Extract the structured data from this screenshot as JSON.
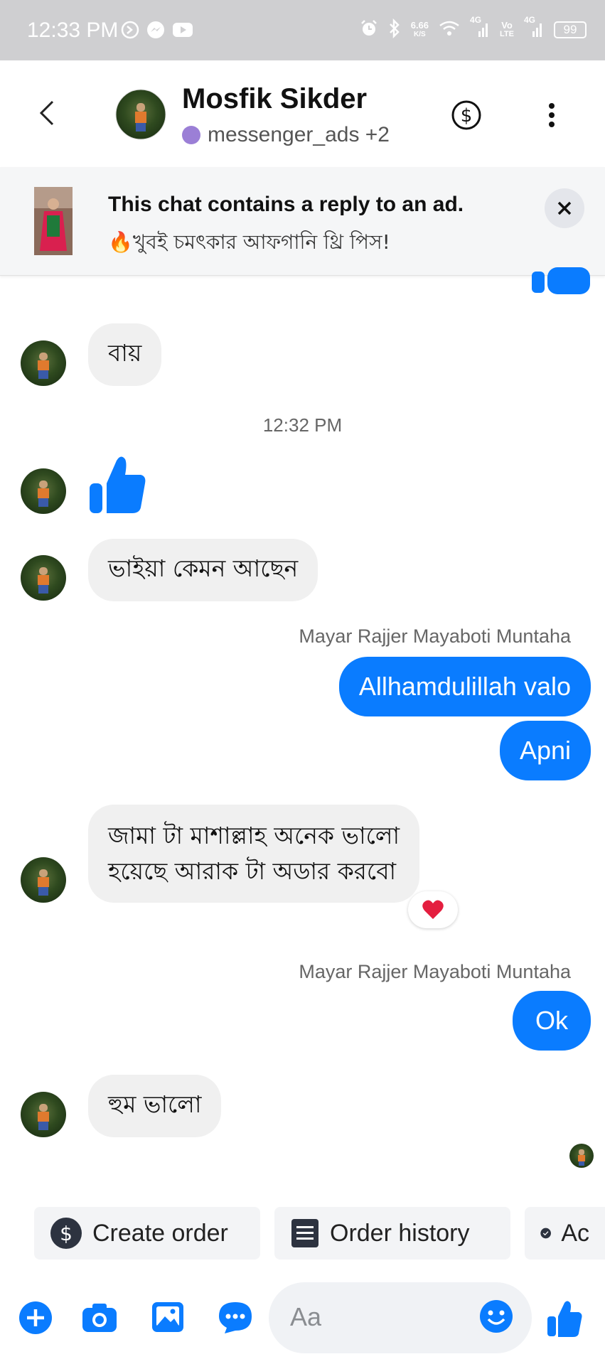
{
  "status_bar": {
    "time": "12:33 PM",
    "net_speed_value": "6.66",
    "net_speed_unit": "K/S",
    "sig1": "4G",
    "volte_top": "Vo",
    "volte_bottom": "LTE",
    "sig2": "4G",
    "battery": "99"
  },
  "header": {
    "name": "Mosfik Sikder",
    "subtitle": "messenger_ads +2"
  },
  "ad_banner": {
    "title": "This chat contains a reply to an ad.",
    "subtitle": "🔥খুবই চমৎকার আফগানি থ্রি পিস!"
  },
  "messages": {
    "m1": "বায়",
    "timestamp": "12:32 PM",
    "m3": "ভাইয়া কেমন আছেন",
    "sender1": "Mayar Rajjer Mayaboti Muntaha",
    "o1": "Allhamdulillah valo",
    "o2": "Apni",
    "m4_line1": "জামা টা মাশাল্লাহ অনেক ভালো",
    "m4_line2": "হয়েছে আরাক টা অডার করবো",
    "sender2": "Mayar Rajjer Mayaboti Muntaha",
    "o3": "Ok",
    "m5": "হুম ভালো"
  },
  "actions": {
    "create_order": "Create order",
    "order_history": "Order history",
    "third": "Ac"
  },
  "composer": {
    "placeholder": "Aa"
  },
  "colors": {
    "accent": "#0a7cff",
    "incoming_bubble": "#f0f0f0",
    "status_bar": "#cfcfd1"
  }
}
